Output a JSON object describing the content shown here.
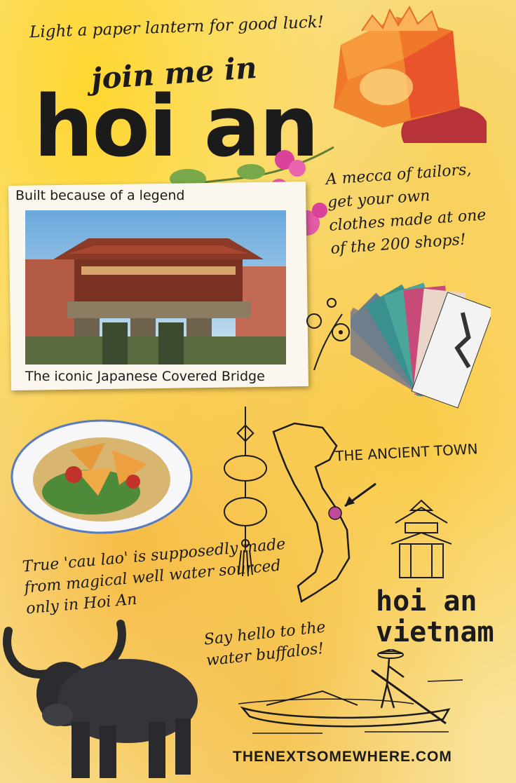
{
  "header": {
    "tagline": "Light a paper lantern for good luck!",
    "title_line1": "join me in",
    "title_line2": "hoi an"
  },
  "tailors_note": "A mecca of tailors, get your own clothes made at one of the 200 shops!",
  "bridge_card": {
    "top_label": "Built because of a legend",
    "caption": "The iconic Japanese Covered Bridge"
  },
  "food_note": "True 'cau lao' is supposedly made from magical well water sourced only in Hoi An",
  "map_label": "THE ANCIENT TOWN",
  "location_badge": {
    "line1": "hoi an",
    "line2": "vietnam"
  },
  "buffalo_note": "Say hello to the water buffalos!",
  "website": "THENEXTSOMEWHERE.COM",
  "colors": {
    "paper": "#f9e39a",
    "watercolor_yellow": "#ffd628",
    "ink": "#1b1b1b",
    "lantern_orange": "#f0782a",
    "map_pin": "#c04a9a"
  },
  "icons": [
    "paper-lantern-illustration",
    "bougainvillea-flowers",
    "fabric-swatches",
    "hanging-lantern-drawing",
    "vietnam-map",
    "pagoda-drawing",
    "water-buffalo",
    "boat-rower-drawing",
    "noodle-bowl"
  ]
}
